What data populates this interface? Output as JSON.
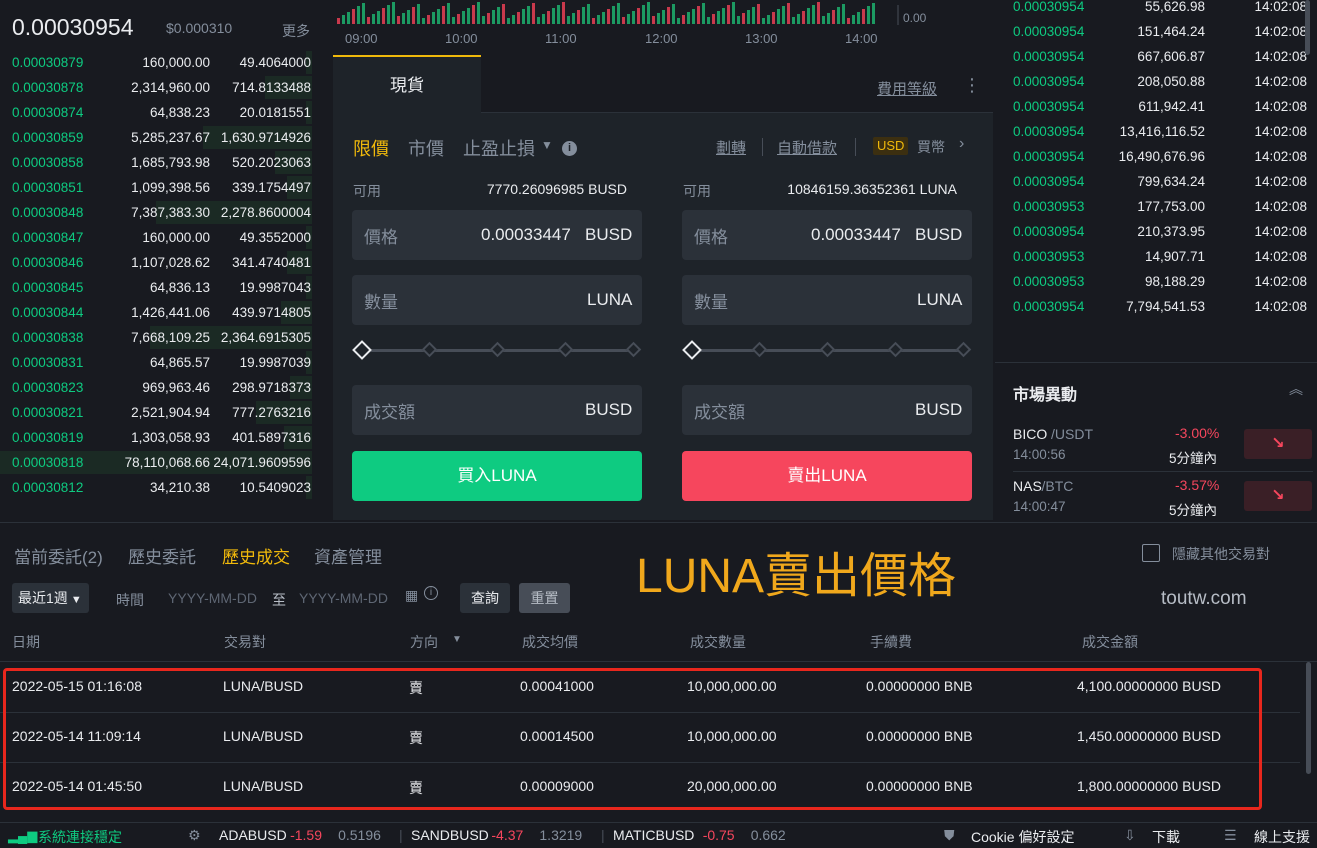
{
  "orderbook": {
    "last_price": "0.00030954",
    "last_price_usd": "$0.000310",
    "more_label": "更多",
    "rows": [
      {
        "price": "0.00030879",
        "amount": "160,000.00",
        "total": "49.4064000"
      },
      {
        "price": "0.00030878",
        "amount": "2,314,960.00",
        "total": "714.8133488"
      },
      {
        "price": "0.00030874",
        "amount": "64,838.23",
        "total": "20.0181551"
      },
      {
        "price": "0.00030859",
        "amount": "5,285,237.67",
        "total": "1,630.9714926"
      },
      {
        "price": "0.00030858",
        "amount": "1,685,793.98",
        "total": "520.2023063"
      },
      {
        "price": "0.00030851",
        "amount": "1,099,398.56",
        "total": "339.1754497"
      },
      {
        "price": "0.00030848",
        "amount": "7,387,383.30",
        "total": "2,278.8600004"
      },
      {
        "price": "0.00030847",
        "amount": "160,000.00",
        "total": "49.3552000"
      },
      {
        "price": "0.00030846",
        "amount": "1,107,028.62",
        "total": "341.4740481"
      },
      {
        "price": "0.00030845",
        "amount": "64,836.13",
        "total": "19.9987043"
      },
      {
        "price": "0.00030844",
        "amount": "1,426,441.06",
        "total": "439.9714805"
      },
      {
        "price": "0.00030838",
        "amount": "7,668,109.25",
        "total": "2,364.6915305"
      },
      {
        "price": "0.00030831",
        "amount": "64,865.57",
        "total": "19.9987039"
      },
      {
        "price": "0.00030823",
        "amount": "969,963.46",
        "total": "298.9718373"
      },
      {
        "price": "0.00030821",
        "amount": "2,521,904.94",
        "total": "777.2763216"
      },
      {
        "price": "0.00030819",
        "amount": "1,303,058.93",
        "total": "401.5897316"
      },
      {
        "price": "0.00030818",
        "amount": "78,110,068.66",
        "total": "24,071.9609596"
      },
      {
        "price": "0.00030812",
        "amount": "34,210.38",
        "total": "10.5409023"
      }
    ],
    "depth_fractions": [
      0.02,
      0.15,
      0.02,
      0.35,
      0.12,
      0.08,
      0.5,
      0.02,
      0.08,
      0.02,
      0.1,
      0.52,
      0.02,
      0.07,
      0.18,
      0.09,
      1.0,
      0.02
    ]
  },
  "chart": {
    "time_labels": [
      "09:00",
      "10:00",
      "11:00",
      "12:00",
      "13:00",
      "14:00"
    ],
    "volume_label": "0.00"
  },
  "trade": {
    "tab_spot": "現貨",
    "fee_level": "費用等級",
    "order_types": {
      "limit": "限價",
      "market": "市價",
      "stop": "止盈止損"
    },
    "transfer": "劃轉",
    "auto_borrow": "自動借款",
    "currency_badge": "USD",
    "buy_coin": "買幣",
    "buy": {
      "avail_label": "可用",
      "avail_value": "7770.26096985 BUSD",
      "price_label": "價格",
      "price_value": "0.00033447",
      "price_unit": "BUSD",
      "qty_label": "數量",
      "qty_unit": "LUNA",
      "total_label": "成交額",
      "total_unit": "BUSD",
      "button": "買入LUNA"
    },
    "sell": {
      "avail_label": "可用",
      "avail_value": "10846159.36352361 LUNA",
      "price_label": "價格",
      "price_value": "0.00033447",
      "price_unit": "BUSD",
      "qty_label": "數量",
      "qty_unit": "LUNA",
      "total_label": "成交額",
      "total_unit": "BUSD",
      "button": "賣出LUNA"
    }
  },
  "trades": [
    {
      "price": "0.00030954",
      "amount": "55,626.98",
      "time": "14:02:08"
    },
    {
      "price": "0.00030954",
      "amount": "151,464.24",
      "time": "14:02:08"
    },
    {
      "price": "0.00030954",
      "amount": "667,606.87",
      "time": "14:02:08"
    },
    {
      "price": "0.00030954",
      "amount": "208,050.88",
      "time": "14:02:08"
    },
    {
      "price": "0.00030954",
      "amount": "611,942.41",
      "time": "14:02:08"
    },
    {
      "price": "0.00030954",
      "amount": "13,416,116.52",
      "time": "14:02:08"
    },
    {
      "price": "0.00030954",
      "amount": "16,490,676.96",
      "time": "14:02:08"
    },
    {
      "price": "0.00030954",
      "amount": "799,634.24",
      "time": "14:02:08"
    },
    {
      "price": "0.00030953",
      "amount": "177,753.00",
      "time": "14:02:08"
    },
    {
      "price": "0.00030954",
      "amount": "210,373.95",
      "time": "14:02:08"
    },
    {
      "price": "0.00030953",
      "amount": "14,907.71",
      "time": "14:02:08"
    },
    {
      "price": "0.00030953",
      "amount": "98,188.29",
      "time": "14:02:08"
    },
    {
      "price": "0.00030954",
      "amount": "7,794,541.53",
      "time": "14:02:08"
    }
  ],
  "market_movers": {
    "title": "市場異動",
    "items": [
      {
        "base": "BICO",
        "quote": "/USDT",
        "time": "14:00:56",
        "change": "-3.00%",
        "window": "5分鐘內"
      },
      {
        "base": "NAS",
        "quote": "/BTC",
        "time": "14:00:47",
        "change": "-3.57%",
        "window": "5分鐘內"
      }
    ]
  },
  "orders": {
    "tabs": [
      "當前委託(2)",
      "歷史委託",
      "歷史成交",
      "資產管理"
    ],
    "active_tab": 2,
    "overlay_title": "LUNA賣出價格",
    "watermark": "toutw.com",
    "hide_pairs": "隱藏其他交易對",
    "range_select": "最近1週",
    "time_label": "時間",
    "date_from": "YYYY-MM-DD",
    "date_to_word": "至",
    "date_to": "YYYY-MM-DD",
    "search": "查詢",
    "reset": "重置",
    "columns": [
      "日期",
      "交易對",
      "方向",
      "成交均價",
      "成交數量",
      "手續費",
      "成交金額"
    ],
    "rows": [
      {
        "date": "2022-05-15 01:16:08",
        "pair": "LUNA/BUSD",
        "side": "賣",
        "avg": "0.00041000",
        "qty": "10,000,000.00",
        "fee": "0.00000000 BNB",
        "total": "4,100.00000000 BUSD"
      },
      {
        "date": "2022-05-14 11:09:14",
        "pair": "LUNA/BUSD",
        "side": "賣",
        "avg": "0.00014500",
        "qty": "10,000,000.00",
        "fee": "0.00000000 BNB",
        "total": "1,450.00000000 BUSD"
      },
      {
        "date": "2022-05-14 01:45:50",
        "pair": "LUNA/BUSD",
        "side": "賣",
        "avg": "0.00009000",
        "qty": "20,000,000.00",
        "fee": "0.00000000 BNB",
        "total": "1,800.00000000 BUSD"
      }
    ]
  },
  "footer": {
    "status": "系統連接穩定",
    "tickers": [
      {
        "sym": "ADABUSD",
        "chg": "-1.59",
        "price": "0.5196"
      },
      {
        "sym": "SANDBUSD",
        "chg": "-4.37",
        "price": "1.3219"
      },
      {
        "sym": "MATICBUSD",
        "chg": "-0.75",
        "price": "0.662"
      }
    ],
    "cookie": "Cookie 偏好設定",
    "download": "下載",
    "support": "線上支援"
  }
}
